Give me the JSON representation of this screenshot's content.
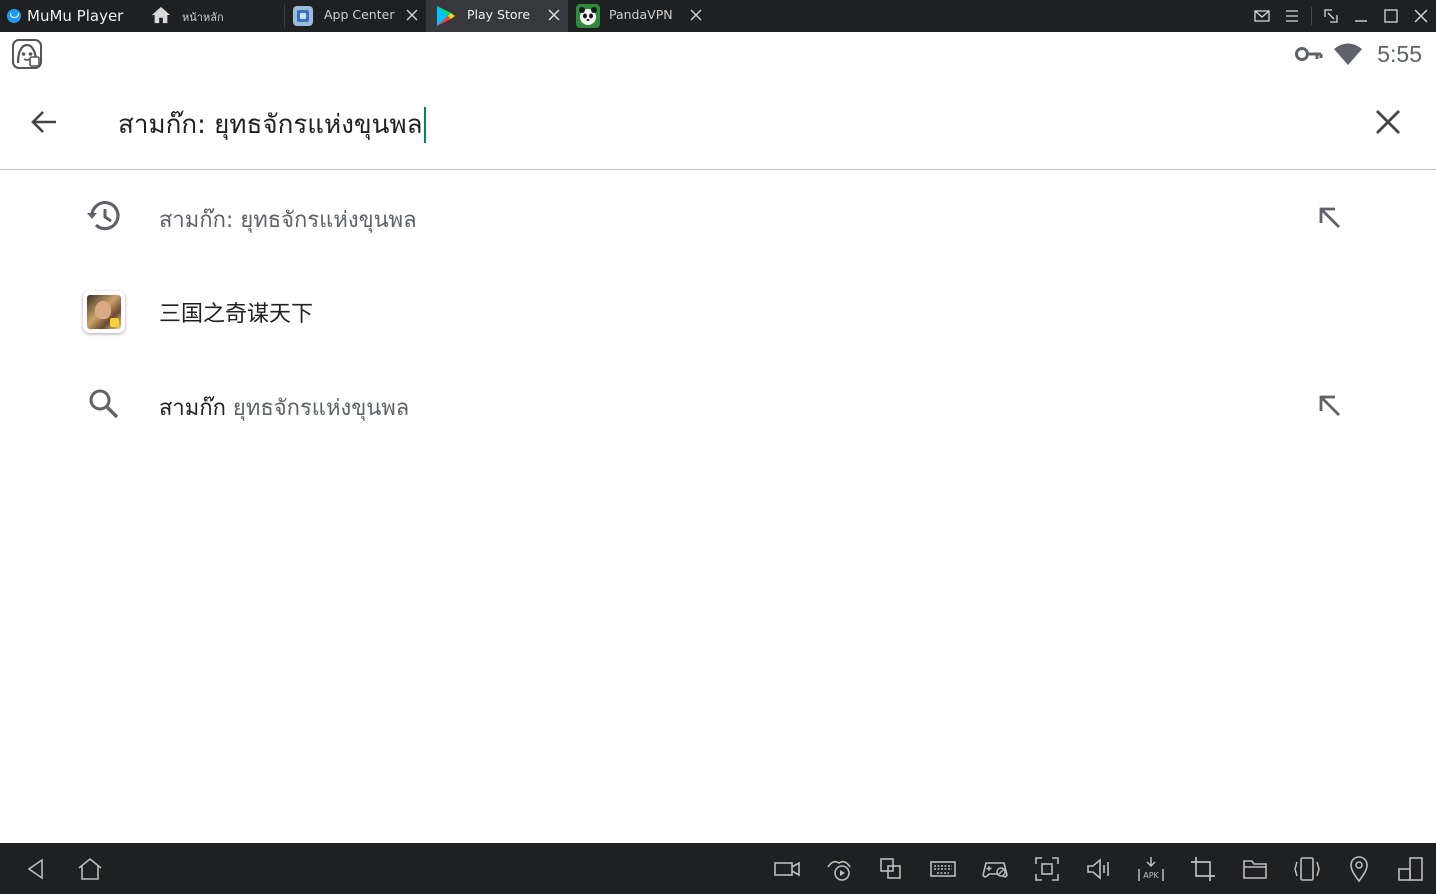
{
  "window": {
    "app_name": "MuMu Player",
    "tabs": [
      {
        "label": "หน้าหลัก",
        "icon": "home-icon",
        "active": false,
        "closable": false
      },
      {
        "label": "App Center",
        "icon": "app-center-icon",
        "active": false,
        "closable": true
      },
      {
        "label": "Play Store",
        "icon": "play-store-icon",
        "active": true,
        "closable": true
      },
      {
        "label": "PandaVPN",
        "icon": "panda-vpn-icon",
        "active": false,
        "closable": true
      }
    ],
    "controls": [
      "mail-icon",
      "menu-icon",
      "shrink-icon",
      "minimize-icon",
      "maximize-icon",
      "close-icon"
    ]
  },
  "status_bar": {
    "time": "5:55",
    "icons": [
      "vpn-key-icon",
      "wifi-icon"
    ]
  },
  "search": {
    "query": "สามก๊ก: ยุทธจักรแห่งขุนพล"
  },
  "suggestions": [
    {
      "type": "history",
      "icon": "history-icon",
      "text": "สามก๊ก: ยุทธจักรแห่งขุนพล",
      "fill_icon": "arrow-up-left-icon"
    },
    {
      "type": "app",
      "icon": "app-thumbnail",
      "text": "三国之奇谋天下"
    },
    {
      "type": "query",
      "icon": "search-icon",
      "prefix": "สามก๊ก",
      "rest": " ยุทธจักรแห่งขุนพล",
      "fill_icon": "arrow-up-left-icon"
    }
  ],
  "toolbar": {
    "left": [
      "nav-back-icon",
      "nav-home-icon"
    ],
    "right": [
      "screen-record-icon",
      "macro-icon",
      "multi-instance-icon",
      "keyboard-icon",
      "gamepad-icon",
      "fullscreen-icon",
      "volume-icon",
      "apk-install-icon",
      "crop-icon",
      "folder-icon",
      "shake-icon",
      "location-icon",
      "rotate-icon"
    ]
  },
  "colors": {
    "titlebar_bg": "#1f2022",
    "active_tab_bg": "#36383c",
    "caret": "#01875f",
    "text_primary": "#202124",
    "text_secondary": "#5f6368"
  }
}
